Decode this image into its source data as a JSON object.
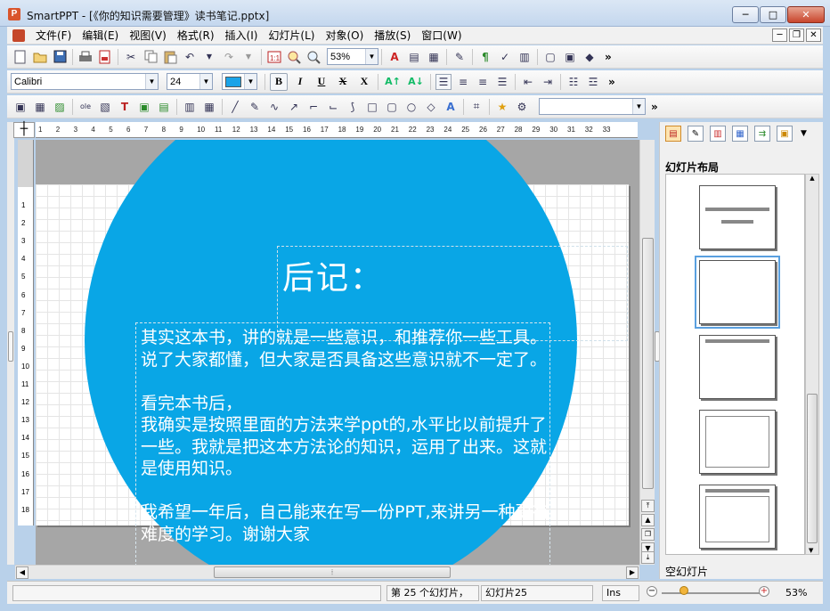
{
  "window": {
    "app_icon": "P",
    "title": "SmartPPT - [《你的知识需要管理》读书笔记.pptx]",
    "controls": {
      "minimize": "─",
      "maximize": "□",
      "close": "✕"
    }
  },
  "menu": {
    "items": [
      "文件(F)",
      "编辑(E)",
      "视图(V)",
      "格式(R)",
      "插入(I)",
      "幻灯片(L)",
      "对象(O)",
      "播放(S)",
      "窗口(W)"
    ],
    "mdi_controls": [
      "─",
      "❐",
      "✕"
    ]
  },
  "toolbar1": {
    "icons": [
      "new-document-icon",
      "open-folder-icon",
      "save-icon",
      "print-icon",
      "pdf-icon",
      "cut-icon",
      "copy-icon",
      "paste-icon",
      "undo-icon",
      "redo-icon",
      "slide-number-icon",
      "zoom-find-icon",
      "magnifier-icon"
    ],
    "zoom_value": "53%",
    "more": "»"
  },
  "toolbar2": {
    "font_name": "Calibri",
    "font_size": "24",
    "font_color": "#1aa3e8",
    "format_buttons": [
      "B",
      "I",
      "U",
      "X",
      "X"
    ],
    "grow_font": "A↑",
    "shrink_font": "A↓",
    "more": "»"
  },
  "toolbar3": {
    "style_dropdown": "",
    "more": "»"
  },
  "ruler": {
    "h_marks": [
      "1",
      "2",
      "3",
      "4",
      "5",
      "6",
      "7",
      "8",
      "9",
      "10",
      "11",
      "12",
      "13",
      "14",
      "15",
      "16",
      "17",
      "18",
      "19",
      "20",
      "21",
      "22",
      "23",
      "24",
      "25",
      "26",
      "27",
      "28",
      "29",
      "30",
      "31",
      "32",
      "33"
    ],
    "v_marks": [
      "1",
      "2",
      "3",
      "4",
      "5",
      "6",
      "7",
      "8",
      "9",
      "10",
      "11",
      "12",
      "13",
      "14",
      "15",
      "16",
      "17",
      "18"
    ]
  },
  "slide": {
    "background_circle_color": "#09a6e6",
    "title": "后记：",
    "body": "其实这本书，讲的就是一些意识，和推荐你一些工具。说了大家都懂，但大家是否具备这些意识就不一定了。\n\n看完本书后，\n我确实是按照里面的方法来学ppt的,水平比以前提升了一些。我就是把这本方法论的知识，运用了出来。这就是使用知识。\n\n我希望一年后，自己能来在写一份PPT,来讲另一种更有难度的学习。谢谢大家"
  },
  "right_pane": {
    "heading": "幻灯片布局",
    "footer_label": "空幻灯片",
    "selected_layout": 1
  },
  "statusbar": {
    "slide_count": "第 25 个幻灯片，",
    "slide_name": "幻灯片25",
    "mode": "Ins",
    "zoom": "53%"
  }
}
